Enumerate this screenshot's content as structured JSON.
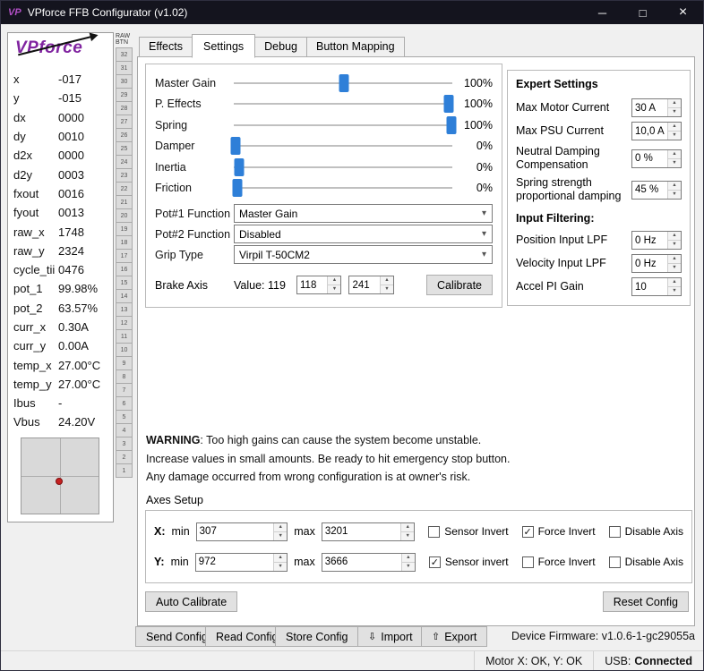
{
  "titlebar": {
    "title": "VPforce FFB Configurator (v1.02)",
    "icon_text": "VP",
    "minimize": "─",
    "maximize": "□",
    "close": "×"
  },
  "icons": {
    "chevron": "▾",
    "up": "▲",
    "down": "▼",
    "import": "⇩",
    "export": "⇧",
    "check": "✓"
  },
  "logo": {
    "text": "VPforce"
  },
  "telemetry": {
    "rows": [
      {
        "label": "x",
        "value": "-017"
      },
      {
        "label": "y",
        "value": "-015"
      },
      {
        "label": "dx",
        "value": "0000"
      },
      {
        "label": "dy",
        "value": "0010"
      },
      {
        "label": "d2x",
        "value": "0000"
      },
      {
        "label": "d2y",
        "value": "0003"
      },
      {
        "label": "fxout",
        "value": "0016"
      },
      {
        "label": "fyout",
        "value": "0013"
      },
      {
        "label": "raw_x",
        "value": "1748"
      },
      {
        "label": "raw_y",
        "value": "2324"
      },
      {
        "label": "cycle_tii",
        "value": "0476"
      },
      {
        "label": "pot_1",
        "value": "99.98%"
      },
      {
        "label": "pot_2",
        "value": "63.57%"
      },
      {
        "label": "curr_x",
        "value": "0.30A"
      },
      {
        "label": "curr_y",
        "value": "0.00A"
      },
      {
        "label": "temp_x",
        "value": "27.00°C"
      },
      {
        "label": "temp_y",
        "value": "27.00°C"
      },
      {
        "label": "Ibus",
        "value": "-"
      },
      {
        "label": "Vbus",
        "value": "24.20V"
      }
    ]
  },
  "raw_buttons": {
    "header_line1": "RAW",
    "header_line2": "BTN",
    "numbers": [
      32,
      31,
      30,
      29,
      28,
      27,
      26,
      25,
      24,
      23,
      22,
      21,
      20,
      19,
      18,
      17,
      16,
      15,
      14,
      13,
      12,
      11,
      10,
      9,
      8,
      7,
      6,
      5,
      4,
      3,
      2,
      1
    ]
  },
  "tabs": [
    {
      "label": "Effects",
      "active": false
    },
    {
      "label": "Settings",
      "active": true
    },
    {
      "label": "Debug",
      "active": false
    },
    {
      "label": "Button Mapping",
      "active": false
    }
  ],
  "main": {
    "sliders": [
      {
        "label": "Master Gain",
        "pos": 50.5,
        "value": "100%"
      },
      {
        "label": "P. Effects",
        "pos": 98.5,
        "value": "100%"
      },
      {
        "label": "Spring",
        "pos": 99.5,
        "value": "100%"
      },
      {
        "label": "Damper",
        "pos": 1,
        "value": "0%"
      },
      {
        "label": "Inertia",
        "pos": 2.5,
        "value": "0%"
      },
      {
        "label": "Friction",
        "pos": 1.5,
        "value": "0%"
      }
    ],
    "dropdowns": [
      {
        "label": "Pot#1 Function",
        "value": "Master Gain"
      },
      {
        "label": "Pot#2 Function",
        "value": "Disabled"
      },
      {
        "label": "Grip Type",
        "value": "Virpil T-50CM2"
      }
    ],
    "brake": {
      "label": "Brake Axis",
      "value_label": "Value:",
      "value": "119",
      "spin1": "118",
      "spin2": "241",
      "calibrate": "Calibrate"
    },
    "expert": {
      "title": "Expert Settings",
      "rows": [
        {
          "label": "Max Motor Current",
          "value": "30 A"
        },
        {
          "label": "Max PSU Current",
          "value": "10,0 A"
        },
        {
          "label": "Neutral Damping Compensation",
          "value": "0 %"
        },
        {
          "label": "Spring strength proportional damping",
          "value": "45 %"
        }
      ],
      "filtering_title": "Input Filtering:",
      "filter_rows": [
        {
          "label": "Position Input LPF",
          "value": "0 Hz"
        },
        {
          "label": "Velocity Input LPF",
          "value": "0 Hz"
        },
        {
          "label": "Accel PI Gain",
          "value": "10"
        }
      ]
    },
    "warning": {
      "bold": "WARNING",
      "line1": ": Too high gains can cause the system become unstable.",
      "line2": "Increase values in small amounts. Be ready to hit emergency stop button.",
      "line3": "Any damage occurred from wrong configuration is at owner's risk."
    },
    "axes": {
      "title": "Axes Setup",
      "rows": [
        {
          "axis": "X:",
          "min_label": "min",
          "min": "307",
          "max_label": "max",
          "max": "3201",
          "checks": [
            {
              "label": "Sensor Invert",
              "checked": false
            },
            {
              "label": "Force Invert",
              "checked": true
            },
            {
              "label": "Disable Axis",
              "checked": false
            }
          ]
        },
        {
          "axis": "Y:",
          "min_label": "min",
          "min": "972",
          "max_label": "max",
          "max": "3666",
          "checks": [
            {
              "label": "Sensor invert",
              "checked": true
            },
            {
              "label": "Force Invert",
              "checked": false
            },
            {
              "label": "Disable Axis",
              "checked": false
            }
          ]
        }
      ],
      "auto_calibrate": "Auto Calibrate",
      "reset_config": "Reset Config"
    }
  },
  "bottom": {
    "send": "Send Config",
    "read": "Read Config",
    "store": "Store Config",
    "import_label": "Import",
    "export_label": "Export",
    "firmware": "Device Firmware: v1.0.6-1-gc29055a"
  },
  "statusbar": {
    "motor": "Motor X: OK, Y: OK",
    "usb_label": "USB:",
    "usb_value": "Connected"
  }
}
